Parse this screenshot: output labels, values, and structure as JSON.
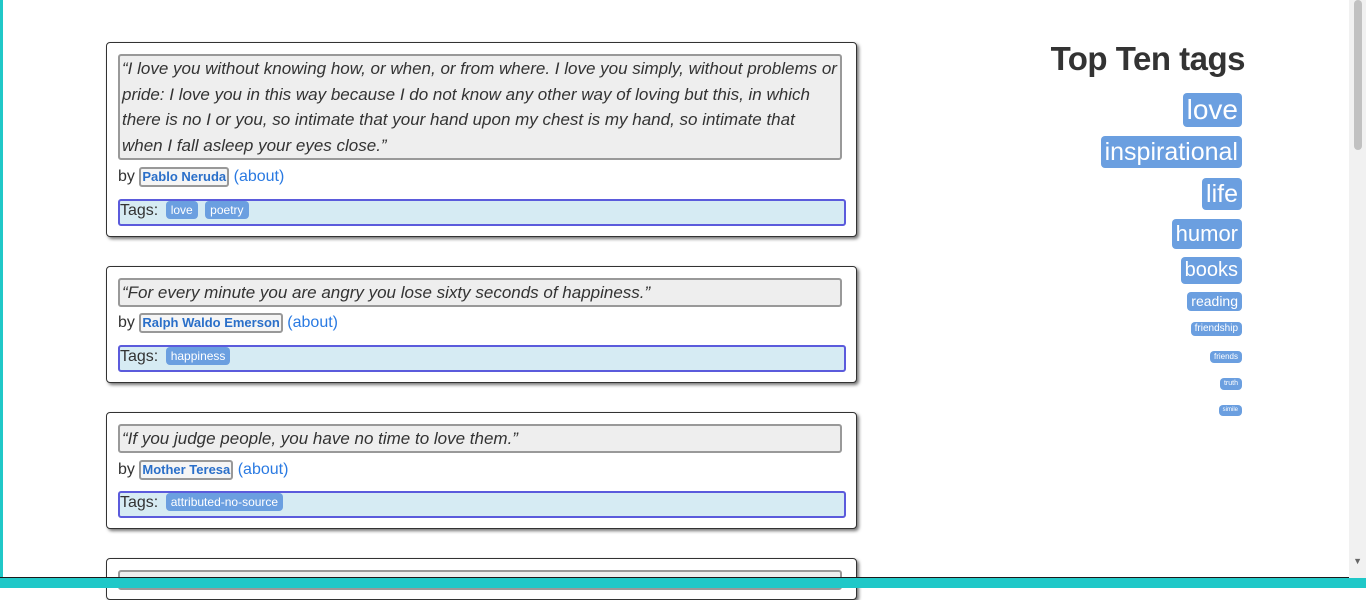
{
  "quotes": [
    {
      "text": "“I love you without knowing how, or when, or from where. I love you simply, without problems or pride: I love you in this way because I do not know any other way of loving but this, in which there is no I or you, so intimate that your hand upon my chest is my hand, so intimate that when I fall asleep your eyes close.”",
      "by_label": "by",
      "author": "Pablo Neruda",
      "about": "(about)",
      "tags_label": "Tags:",
      "tags": [
        "love",
        "poetry"
      ]
    },
    {
      "text": "“For every minute you are angry you lose sixty seconds of happiness.”",
      "by_label": "by",
      "author": "Ralph Waldo Emerson",
      "about": "(about)",
      "tags_label": "Tags:",
      "tags": [
        "happiness"
      ]
    },
    {
      "text": "“If you judge people, you have no time to love them.”",
      "by_label": "by",
      "author": "Mother Teresa",
      "about": "(about)",
      "tags_label": "Tags:",
      "tags": [
        "attributed-no-source"
      ]
    }
  ],
  "top_tags": {
    "title": "Top Ten tags",
    "tags": [
      "love",
      "inspirational",
      "life",
      "humor",
      "books",
      "reading",
      "friendship",
      "friends",
      "truth",
      "simile"
    ]
  },
  "colors": {
    "accent": "#20c8c8",
    "tag_bg": "#6b9fe0",
    "tags_row_bg": "#d6ebf3",
    "tags_row_border": "#5b5bdc",
    "link": "#2a7ae2"
  }
}
